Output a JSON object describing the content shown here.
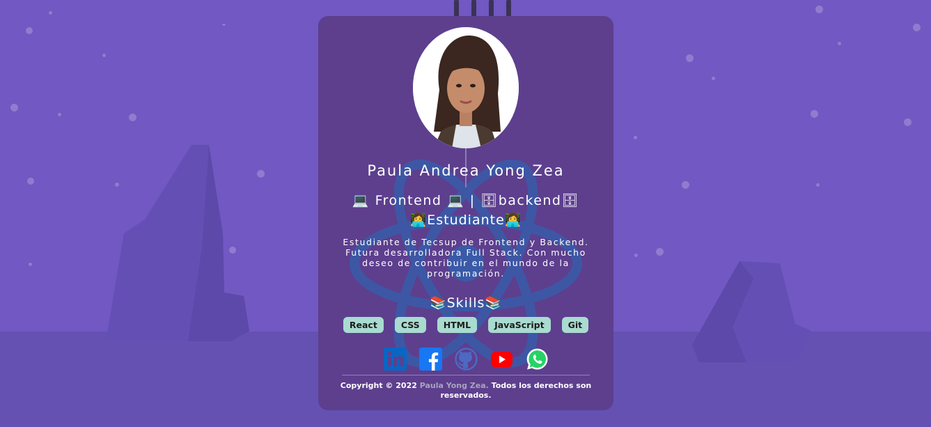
{
  "profile": {
    "name": "Paula Andrea Yong Zea",
    "role": "💻 Frontend 💻 | 🗄backend🗄",
    "status": "👩‍💻Estudiante👩‍💻",
    "bio": "Estudiante de Tecsup de Frontend y Backend. Futura desarrolladora Full Stack. Con mucho deseo de contribuir en el mundo de la programación."
  },
  "skills": {
    "title": "📚Skills📚",
    "items": [
      "React",
      "CSS",
      "HTML",
      "JavaScript",
      "Git"
    ]
  },
  "socials": [
    "linkedin-icon",
    "facebook-icon",
    "github-icon",
    "youtube-icon",
    "whatsapp-icon"
  ],
  "footer": {
    "prefix": "Copyright © 2022 ",
    "highlight": "Paula Yong Zea.",
    "suffix": " Todos los derechos son reservados."
  },
  "colors": {
    "background": "#7158c2",
    "card": "#5d3f8e",
    "skill_badge": "#a9dbd0",
    "react_logo": "#3a5aa8"
  }
}
